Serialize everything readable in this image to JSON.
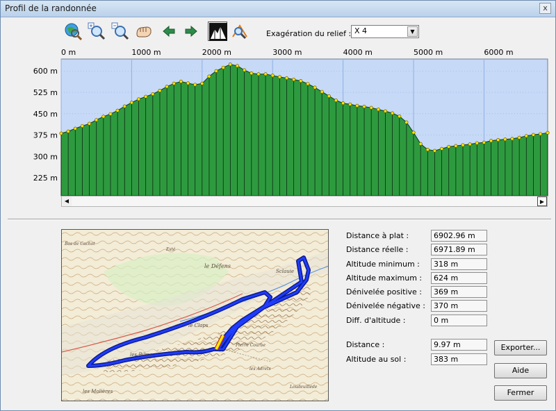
{
  "window": {
    "title": "Profil de la randonnée",
    "close_glyph": "x"
  },
  "toolbar": {
    "icons": [
      "globe-zoom-icon",
      "zoom-in-icon",
      "zoom-out-icon",
      "pan-hand-icon",
      "arrow-left-icon",
      "arrow-right-icon",
      "relief-mountain-icon",
      "profile-tool-icon"
    ],
    "relief_label": "Exagération du relief :",
    "relief_value": "X 4"
  },
  "chart_data": {
    "type": "area",
    "x_ticks": [
      "0 m",
      "1000 m",
      "2000 m",
      "3000 m",
      "4000 m",
      "5000 m",
      "6000 m"
    ],
    "y_ticks": [
      "600 m",
      "525 m",
      "450 m",
      "375 m",
      "300 m",
      "225 m"
    ],
    "xlim": [
      0,
      6903
    ],
    "ylim": [
      162,
      642
    ],
    "colors": {
      "background": "#c6d9f6",
      "fill": "#2e9a3f",
      "grid": "#8fb0e6",
      "point": "#ffe400"
    },
    "x": [
      0,
      100,
      200,
      300,
      400,
      500,
      600,
      700,
      800,
      900,
      1000,
      1100,
      1200,
      1300,
      1400,
      1500,
      1600,
      1700,
      1800,
      1900,
      2000,
      2100,
      2200,
      2300,
      2400,
      2500,
      2600,
      2700,
      2800,
      2900,
      3000,
      3100,
      3200,
      3300,
      3400,
      3500,
      3600,
      3700,
      3800,
      3900,
      4000,
      4100,
      4200,
      4300,
      4400,
      4500,
      4600,
      4700,
      4800,
      4900,
      5000,
      5100,
      5200,
      5300,
      5400,
      5500,
      5600,
      5700,
      5800,
      5900,
      6000,
      6100,
      6200,
      6300,
      6400,
      6500,
      6600,
      6700,
      6800,
      6903
    ],
    "y": [
      381,
      388,
      398,
      407,
      415,
      428,
      440,
      449,
      461,
      476,
      489,
      501,
      510,
      519,
      531,
      545,
      556,
      563,
      557,
      552,
      556,
      581,
      600,
      612,
      623,
      618,
      603,
      592,
      589,
      589,
      584,
      579,
      575,
      570,
      565,
      555,
      542,
      527,
      512,
      497,
      487,
      483,
      478,
      475,
      471,
      465,
      459,
      452,
      441,
      420,
      384,
      344,
      324,
      320,
      327,
      334,
      337,
      340,
      343,
      347,
      349,
      355,
      358,
      360,
      362,
      366,
      372,
      376,
      379,
      383
    ]
  },
  "stats": [
    {
      "label": "Distance à plat :",
      "value": "6902.96 m"
    },
    {
      "label": "Distance réelle :",
      "value": "6971.89 m"
    },
    {
      "label": "Altitude minimum :",
      "value": "318 m"
    },
    {
      "label": "Altitude maximum :",
      "value": "624 m"
    },
    {
      "label": "Dénivelée positive :",
      "value": "369 m"
    },
    {
      "label": "Dénivelée négative :",
      "value": "370 m"
    },
    {
      "label": "Diff. d'altitude :",
      "value": "0 m"
    }
  ],
  "cursor": [
    {
      "label": "Distance :",
      "value": "9.97 m"
    },
    {
      "label": "Altitude au sol :",
      "value": "383 m"
    }
  ],
  "buttons": {
    "export": "Exporter...",
    "help": "Aide",
    "close": "Fermer"
  },
  "map": {
    "labels": [
      "le Défens",
      "le Claps",
      "les Ribas",
      "Sclauie",
      "les Adrets",
      "les Molières",
      "Pierre Courbe",
      "Esté",
      "Loudeuillede",
      "Bas de Cachot"
    ],
    "route_color": "#1f3cff",
    "marker_color": "#ffef00"
  }
}
